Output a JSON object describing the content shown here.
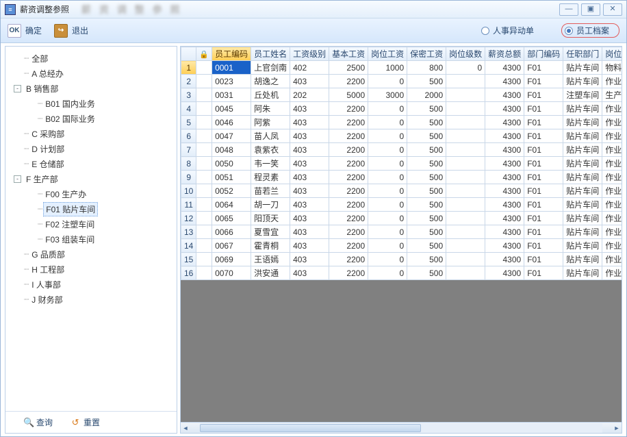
{
  "window": {
    "title": "薪资调整参照",
    "blur_text": "薪 资 调 整 参 照"
  },
  "win_buttons": {
    "min": "—",
    "max": "▣",
    "close": "✕"
  },
  "toolbar": {
    "ok_label": "确定",
    "exit_label": "退出",
    "ok_icon": "OK",
    "exit_icon": "↪"
  },
  "radios": {
    "option1": "人事异动单",
    "option2": "员工档案"
  },
  "tree": [
    {
      "indent": 0,
      "expander": "",
      "dots": "┈",
      "label": "全部",
      "selected": false
    },
    {
      "indent": 0,
      "expander": "",
      "dots": "┈",
      "label": "A 总经办",
      "selected": false
    },
    {
      "indent": 0,
      "expander": "-",
      "dots": "",
      "label": "B 销售部",
      "selected": false
    },
    {
      "indent": 1,
      "expander": "",
      "dots": "┈",
      "label": "B01 国内业务",
      "selected": false
    },
    {
      "indent": 1,
      "expander": "",
      "dots": "┈",
      "label": "B02 国际业务",
      "selected": false
    },
    {
      "indent": 0,
      "expander": "",
      "dots": "┈",
      "label": "C 采购部",
      "selected": false
    },
    {
      "indent": 0,
      "expander": "",
      "dots": "┈",
      "label": "D 计划部",
      "selected": false
    },
    {
      "indent": 0,
      "expander": "",
      "dots": "┈",
      "label": "E 仓储部",
      "selected": false
    },
    {
      "indent": 0,
      "expander": "-",
      "dots": "",
      "label": "F 生产部",
      "selected": false
    },
    {
      "indent": 1,
      "expander": "",
      "dots": "┈",
      "label": "F00 生产办",
      "selected": false
    },
    {
      "indent": 1,
      "expander": "",
      "dots": "┈",
      "label": "F01 贴片车间",
      "selected": true
    },
    {
      "indent": 1,
      "expander": "",
      "dots": "┈",
      "label": "F02 注塑车间",
      "selected": false
    },
    {
      "indent": 1,
      "expander": "",
      "dots": "┈",
      "label": "F03 组装车间",
      "selected": false
    },
    {
      "indent": 0,
      "expander": "",
      "dots": "┈",
      "label": "G 品质部",
      "selected": false
    },
    {
      "indent": 0,
      "expander": "",
      "dots": "┈",
      "label": "H 工程部",
      "selected": false
    },
    {
      "indent": 0,
      "expander": "",
      "dots": "┈",
      "label": "I 人事部",
      "selected": false
    },
    {
      "indent": 0,
      "expander": "",
      "dots": "┈",
      "label": "J 财务部",
      "selected": false
    }
  ],
  "left_bottom": {
    "query_label": "查询",
    "reset_label": "重置"
  },
  "grid": {
    "lock_header": "🔒",
    "columns": [
      {
        "key": "code",
        "label": "员工编码",
        "width": 54,
        "align": "cell-code"
      },
      {
        "key": "name",
        "label": "员工姓名",
        "width": 56,
        "align": "cell-txt"
      },
      {
        "key": "grade",
        "label": "工资级别",
        "width": 54,
        "align": "cell-txt"
      },
      {
        "key": "base",
        "label": "基本工资",
        "width": 56,
        "align": "cell-num"
      },
      {
        "key": "post",
        "label": "岗位工资",
        "width": 56,
        "align": "cell-num"
      },
      {
        "key": "sec",
        "label": "保密工资",
        "width": 56,
        "align": "cell-num"
      },
      {
        "key": "lvl",
        "label": "岗位级数",
        "width": 56,
        "align": "cell-num"
      },
      {
        "key": "total",
        "label": "薪资总额",
        "width": 56,
        "align": "cell-num"
      },
      {
        "key": "dept",
        "label": "部门编码",
        "width": 56,
        "align": "cell-txt"
      },
      {
        "key": "job",
        "label": "任职部门",
        "width": 56,
        "align": "cell-txt"
      },
      {
        "key": "pos",
        "label": "岗位",
        "width": 36,
        "align": "cell-txt"
      }
    ],
    "selected_col": "code",
    "selected_row": 1,
    "rows": [
      {
        "n": 1,
        "code": "0001",
        "name": "上官剑南",
        "grade": "402",
        "base": "2500",
        "post": "1000",
        "sec": "800",
        "lvl": "0",
        "total": "4300",
        "dept": "F01",
        "job": "贴片车间",
        "pos": "物料"
      },
      {
        "n": 2,
        "code": "0023",
        "name": "胡逸之",
        "grade": "403",
        "base": "2200",
        "post": "0",
        "sec": "500",
        "lvl": "",
        "total": "4300",
        "dept": "F01",
        "job": "贴片车间",
        "pos": "作业"
      },
      {
        "n": 3,
        "code": "0031",
        "name": "丘处机",
        "grade": "202",
        "base": "5000",
        "post": "3000",
        "sec": "2000",
        "lvl": "",
        "total": "4300",
        "dept": "F01",
        "job": "注塑车间",
        "pos": "生产"
      },
      {
        "n": 4,
        "code": "0045",
        "name": "阿朱",
        "grade": "403",
        "base": "2200",
        "post": "0",
        "sec": "500",
        "lvl": "",
        "total": "4300",
        "dept": "F01",
        "job": "贴片车间",
        "pos": "作业"
      },
      {
        "n": 5,
        "code": "0046",
        "name": "阿紫",
        "grade": "403",
        "base": "2200",
        "post": "0",
        "sec": "500",
        "lvl": "",
        "total": "4300",
        "dept": "F01",
        "job": "贴片车间",
        "pos": "作业"
      },
      {
        "n": 6,
        "code": "0047",
        "name": "苗人凤",
        "grade": "403",
        "base": "2200",
        "post": "0",
        "sec": "500",
        "lvl": "",
        "total": "4300",
        "dept": "F01",
        "job": "贴片车间",
        "pos": "作业"
      },
      {
        "n": 7,
        "code": "0048",
        "name": "袁紫衣",
        "grade": "403",
        "base": "2200",
        "post": "0",
        "sec": "500",
        "lvl": "",
        "total": "4300",
        "dept": "F01",
        "job": "贴片车间",
        "pos": "作业"
      },
      {
        "n": 8,
        "code": "0050",
        "name": "韦一笑",
        "grade": "403",
        "base": "2200",
        "post": "0",
        "sec": "500",
        "lvl": "",
        "total": "4300",
        "dept": "F01",
        "job": "贴片车间",
        "pos": "作业"
      },
      {
        "n": 9,
        "code": "0051",
        "name": "程灵素",
        "grade": "403",
        "base": "2200",
        "post": "0",
        "sec": "500",
        "lvl": "",
        "total": "4300",
        "dept": "F01",
        "job": "贴片车间",
        "pos": "作业"
      },
      {
        "n": 10,
        "code": "0052",
        "name": "苗若兰",
        "grade": "403",
        "base": "2200",
        "post": "0",
        "sec": "500",
        "lvl": "",
        "total": "4300",
        "dept": "F01",
        "job": "贴片车间",
        "pos": "作业"
      },
      {
        "n": 11,
        "code": "0064",
        "name": "胡一刀",
        "grade": "403",
        "base": "2200",
        "post": "0",
        "sec": "500",
        "lvl": "",
        "total": "4300",
        "dept": "F01",
        "job": "贴片车间",
        "pos": "作业"
      },
      {
        "n": 12,
        "code": "0065",
        "name": "阳顶天",
        "grade": "403",
        "base": "2200",
        "post": "0",
        "sec": "500",
        "lvl": "",
        "total": "4300",
        "dept": "F01",
        "job": "贴片车间",
        "pos": "作业"
      },
      {
        "n": 13,
        "code": "0066",
        "name": "夏雪宜",
        "grade": "403",
        "base": "2200",
        "post": "0",
        "sec": "500",
        "lvl": "",
        "total": "4300",
        "dept": "F01",
        "job": "贴片车间",
        "pos": "作业"
      },
      {
        "n": 14,
        "code": "0067",
        "name": "霍青桐",
        "grade": "403",
        "base": "2200",
        "post": "0",
        "sec": "500",
        "lvl": "",
        "total": "4300",
        "dept": "F01",
        "job": "贴片车间",
        "pos": "作业"
      },
      {
        "n": 15,
        "code": "0069",
        "name": "王语嫣",
        "grade": "403",
        "base": "2200",
        "post": "0",
        "sec": "500",
        "lvl": "",
        "total": "4300",
        "dept": "F01",
        "job": "贴片车间",
        "pos": "作业"
      },
      {
        "n": 16,
        "code": "0070",
        "name": "洪安通",
        "grade": "403",
        "base": "2200",
        "post": "0",
        "sec": "500",
        "lvl": "",
        "total": "4300",
        "dept": "F01",
        "job": "贴片车间",
        "pos": "作业"
      }
    ]
  }
}
